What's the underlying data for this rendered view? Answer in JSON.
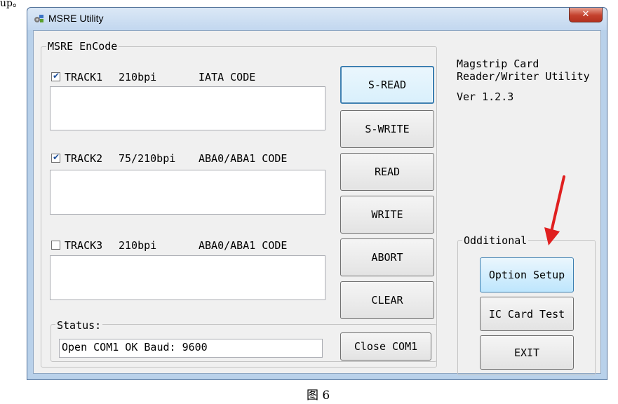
{
  "stray_text": "up。",
  "window": {
    "title": "MSRE Utility",
    "close_glyph": "✕"
  },
  "encode_group": {
    "legend": "MSRE EnCode",
    "tracks": [
      {
        "checked": true,
        "name": "TRACK1",
        "bpi": "210bpi",
        "code": "IATA CODE",
        "value": ""
      },
      {
        "checked": true,
        "name": "TRACK2",
        "bpi": "75/210bpi",
        "code": "ABA0/ABA1 CODE",
        "value": ""
      },
      {
        "checked": false,
        "name": "TRACK3",
        "bpi": "210bpi",
        "code": "ABA0/ABA1 CODE",
        "value": ""
      }
    ]
  },
  "buttons": {
    "s_read": "S-READ",
    "s_write": "S-WRITE",
    "read": "READ",
    "write": "WRITE",
    "abort": "ABORT",
    "clear": "CLEAR",
    "close_com": "Close COM1"
  },
  "status": {
    "legend": "Status:",
    "value": "Open COM1 OK Baud: 9600"
  },
  "info": {
    "line1": "Magstrip Card",
    "line2": "Reader/Writer Utility",
    "version": "Ver 1.2.3"
  },
  "additional": {
    "legend": "Odditional",
    "option_setup": "Option Setup",
    "ic_card_test": "IC Card Test",
    "exit": "EXIT"
  },
  "caption": "图 6",
  "colors": {
    "annotation_arrow": "#e02020",
    "default_button_border": "#3c7fb1"
  }
}
